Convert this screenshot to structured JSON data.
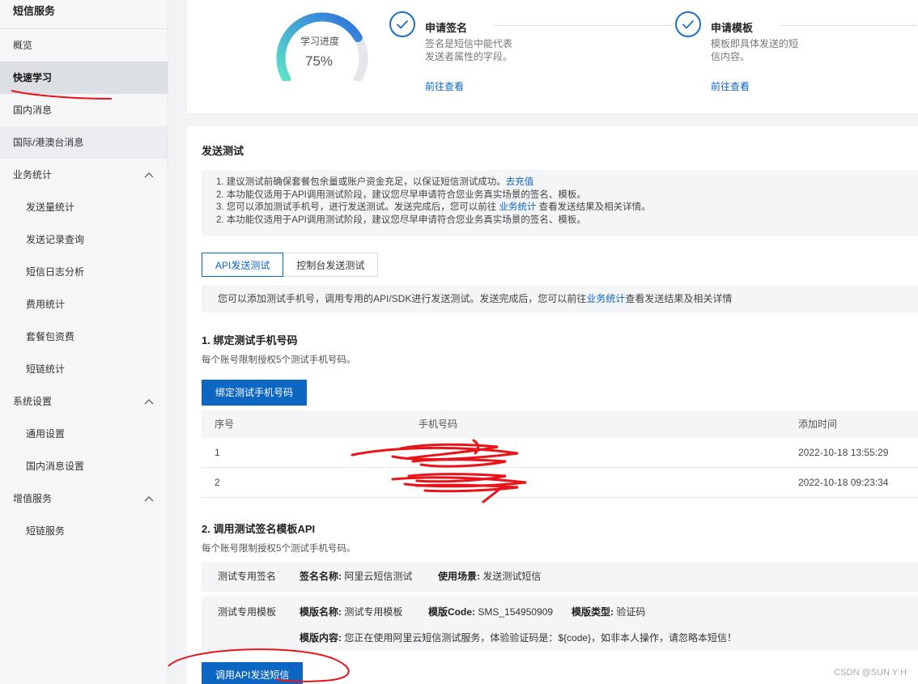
{
  "sidebar": {
    "title": "短信服务",
    "items": [
      {
        "label": "概览"
      },
      {
        "label": "快速学习"
      },
      {
        "label": "国内消息"
      },
      {
        "label": "国际/港澳台消息"
      }
    ],
    "groups": [
      {
        "label": "业务统计",
        "children": [
          "发送量统计",
          "发送记录查询",
          "短信日志分析",
          "费用统计",
          "套餐包资费",
          "短链统计"
        ]
      },
      {
        "label": "系统设置",
        "children": [
          "通用设置",
          "国内消息设置"
        ]
      },
      {
        "label": "增值服务",
        "children": [
          "短链服务"
        ]
      }
    ]
  },
  "progress": {
    "label": "学习进度",
    "value_text": "75%",
    "value": 75
  },
  "steps": [
    {
      "title": "申请签名",
      "desc": "签名是短信中能代表发送者属性的字段。",
      "link": "前往查看"
    },
    {
      "title": "申请模板",
      "desc": "模板即具体发送的短信内容。",
      "link": "前往查看"
    }
  ],
  "send_test": {
    "title": "发送测试",
    "notice": {
      "line1_prefix": "1. 建议测试前确保套餐包余量或账户资金充足，以保证短信测试成功。",
      "line1_link": "去充值",
      "line2": "2. 本功能仅适用于API调用测试阶段，建议您尽早申请符合您业务真实场景的签名、模板。",
      "line3_prefix": "3. 您可以添加测试手机号，进行发送测试。发送完成后，您可以前往 ",
      "line3_link": "业务统计",
      "line3_suffix": " 查看发送结果及相关详情。",
      "line4": "2. 本功能仅适用于API调用测试阶段，建议您尽早申请符合您业务真实场景的签名、模板。"
    },
    "tabs": [
      "API发送测试",
      "控制台发送测试"
    ],
    "tab_info_prefix": "您可以添加测试手机号，调用专用的API/SDK进行发送测试。发送完成后，您可以前往",
    "tab_info_link": "业务统计",
    "tab_info_suffix": "查看发送结果及相关详情",
    "section1": {
      "title": "1. 绑定测试手机号码",
      "desc": "每个账号限制授权5个测试手机号码。",
      "button": "绑定测试手机号码"
    },
    "table": {
      "headers": [
        "序号",
        "手机号码",
        "添加时间"
      ],
      "rows": [
        {
          "index": "1",
          "phone": "",
          "time": "2022-10-18 13:55:29"
        },
        {
          "index": "2",
          "phone": "",
          "time": "2022-10-18 09:23:34"
        }
      ]
    },
    "section2": {
      "title": "2. 调用测试签名模板API",
      "desc": "每个账号限制授权5个测试手机号码。",
      "sign_row": {
        "label": "测试专用签名",
        "name_key": "签名名称:",
        "name_val": "阿里云短信测试",
        "scene_key": "使用场景:",
        "scene_val": "发送测试短信"
      },
      "template_row": {
        "label": "测试专用模板",
        "name_key": "模版名称:",
        "name_val": "测试专用模板",
        "code_key": "模版Code:",
        "code_val": "SMS_154950909",
        "type_key": "模版类型:",
        "type_val": "验证码",
        "content_key": "模版内容:",
        "content_val": "您正在使用阿里云短信测试服务，体验验证码是：${code}，如非本人操作，请忽略本短信！"
      },
      "button": "调用API发送短信"
    }
  },
  "watermark": "CSDN @SUN Y H",
  "colors": {
    "primary": "#0d66c2",
    "annotation": "#e8141a"
  }
}
